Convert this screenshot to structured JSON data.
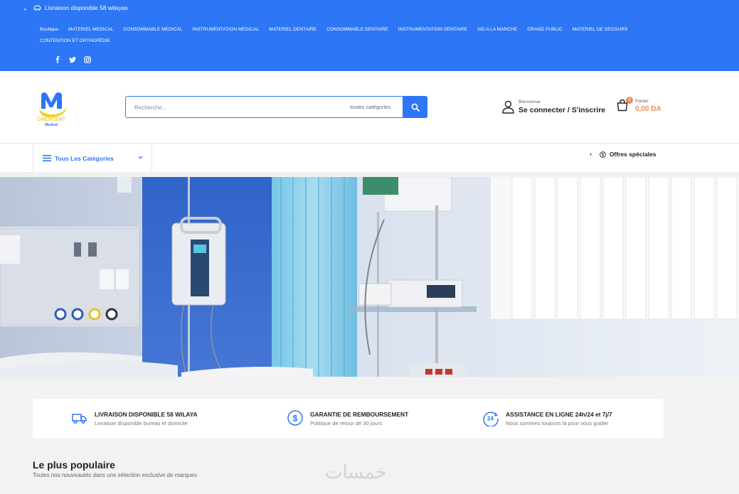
{
  "topbar": {
    "delivery_text": "Livraison disponible 58 wilayas",
    "nav": [
      "Boutique",
      "MATERIEL MEDICAL",
      "CONSOMMABLE MEDICAL",
      "INSTRUMENTATION MEDICAL",
      "MATERIEL DENTAIRE",
      "CONSOMMABLE DENTAIRE",
      "INSTRUMENTATION DENTAIRE",
      "AID A LA MARCHE",
      "GRAND PUBLIC",
      "MATERIEL DE SECOURS",
      "CONTENTION ET ORTHOPÉDIE"
    ],
    "socials": [
      "facebook-icon",
      "twitter-icon",
      "instagram-icon"
    ]
  },
  "header": {
    "logo_text": "CRESCENT",
    "logo_sub": "Medical",
    "search": {
      "placeholder": "Recherche...",
      "category": "toutes catégories"
    },
    "account": {
      "greeting": "Bienvenue",
      "action": "Se connecter / S'inscrire"
    },
    "cart": {
      "label": "Panier",
      "count": "0",
      "amount": "0,00 DA"
    }
  },
  "catbar": {
    "all_categories": "Tous Les Catégories",
    "offers": "Offres spéciales"
  },
  "features": [
    {
      "icon": "truck-icon",
      "title": "LIVRAISON DISPONIBLE 58 WILAYA",
      "desc": "Livraison disponible bureau et domicile"
    },
    {
      "icon": "dollar-circle-icon",
      "title": "GARANTIE DE REMBOURSEMENT",
      "desc": "Politique de retour de 30 jours"
    },
    {
      "icon": "24h-icon",
      "title": "ASSISTANCE EN LIGNE 24h/24 et 7j/7",
      "desc": "Nous sommes toujours là pour vous guider"
    }
  ],
  "popular": {
    "title": "Le plus populaire",
    "subtitle": "Toutes nos nouveautés dans une sélection exclusive de marques"
  },
  "watermark": "خمسات",
  "colors": {
    "primary": "#2d76f5",
    "accent": "#ee8a5f",
    "logo_yellow": "#f2d21f"
  }
}
